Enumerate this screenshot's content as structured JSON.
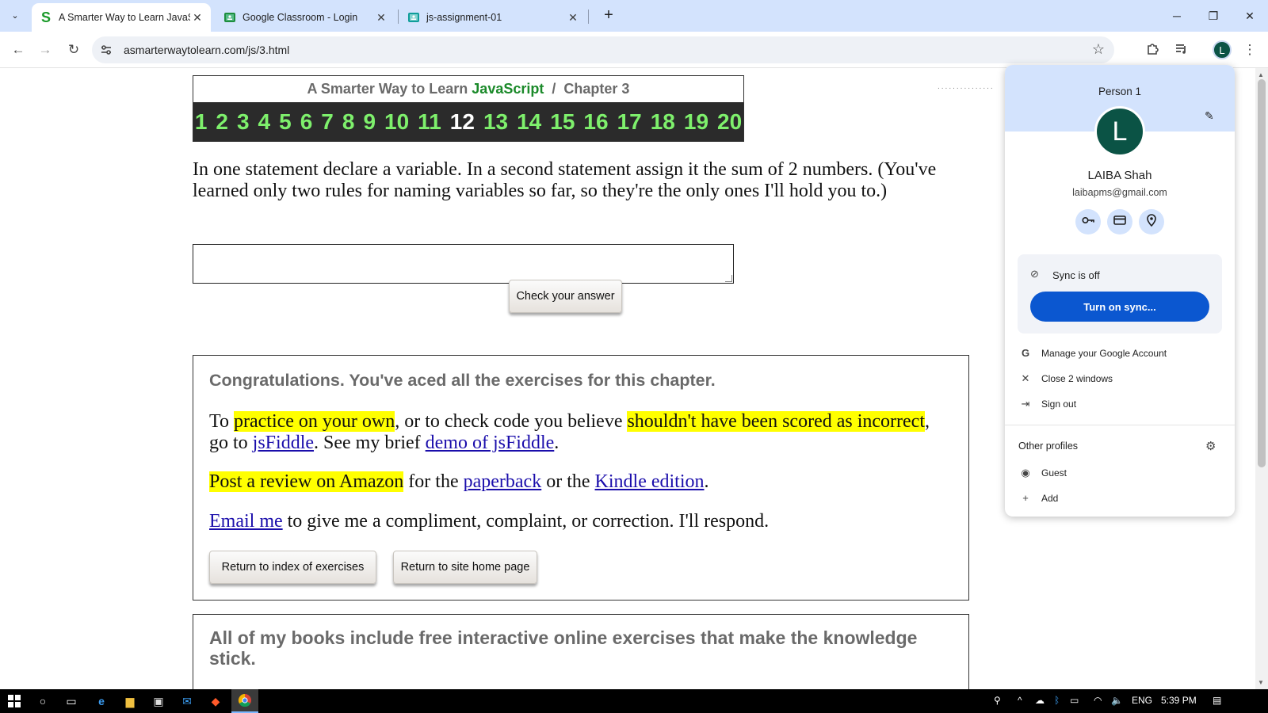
{
  "tabs": [
    {
      "title": "A Smarter Way to Learn JavaScr",
      "active": true,
      "favicon": "s-green-icon"
    },
    {
      "title": "Google Classroom - Login",
      "active": false,
      "favicon": "classroom-icon"
    },
    {
      "title": "js-assignment-01",
      "active": false,
      "favicon": "classroom-icon"
    }
  ],
  "address_bar": {
    "url": "asmarterwaytolearn.com/js/3.html"
  },
  "chapter": {
    "site_title": "A Smarter Way to Learn",
    "language": "JavaScript",
    "separator": "/",
    "chapter_label": "Chapter 3",
    "numbers": [
      "1",
      "2",
      "3",
      "4",
      "5",
      "6",
      "7",
      "8",
      "9",
      "10",
      "11",
      "12",
      "13",
      "14",
      "15",
      "16",
      "17",
      "18",
      "19",
      "20"
    ],
    "current": "12"
  },
  "exercise": {
    "question": "In one statement declare a variable. In a second statement assign it the sum of 2 numbers. (You've learned only two rules for naming variables so far, so they're the only ones I'll hold you to.)",
    "answer_value": "",
    "check_button": "Check your answer"
  },
  "congrats": {
    "heading": "Congratulations. You've aced all the exercises for this chapter.",
    "p1": {
      "t1": "To ",
      "h1": "practice on your own",
      "t2": ", or to check code you believe ",
      "h2": "shouldn't have been scored as incorrect",
      "t3": ", go to ",
      "l1": "jsFiddle",
      "t4": ". See my brief ",
      "l2": "demo of jsFiddle",
      "t5": "."
    },
    "p2": {
      "h1": "Post a review on Amazon",
      "t1": " for the ",
      "l1": "paperback",
      "t2": " or the ",
      "l2": "Kindle edition",
      "t3": "."
    },
    "p3": {
      "l1": "Email me",
      "t1": " to give me a compliment, complaint, or correction. I'll respond."
    },
    "btn_index": "Return to index of exercises",
    "btn_home": "Return to site home page"
  },
  "books": {
    "heading": "All of my books include free interactive online exercises that make the knowledge stick."
  },
  "profile_menu": {
    "person": "Person 1",
    "avatar_letter": "L",
    "name": "LAIBA Shah",
    "email": "laibapms@gmail.com",
    "sync_status": "Sync is off",
    "sync_button": "Turn on sync...",
    "items": [
      "Manage your Google Account",
      "Close 2 windows",
      "Sign out"
    ],
    "other_profiles_label": "Other profiles",
    "other_profiles": [
      "Guest",
      "Add"
    ]
  },
  "taskbar": {
    "lang": "ENG",
    "time": "5:39 PM"
  },
  "colors": {
    "tab_strip": "#d3e3fd",
    "js_green": "#1b8a2a",
    "chapter_numbers": "#7ef06c",
    "highlight": "#ffff00",
    "sync_button": "#0b57d0",
    "avatar": "#0b5345"
  }
}
